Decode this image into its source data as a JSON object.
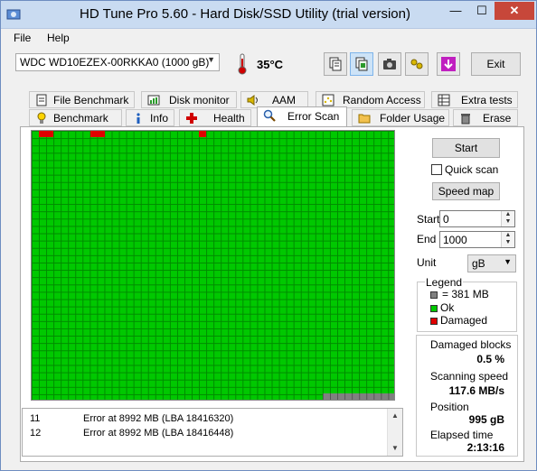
{
  "window": {
    "title": "HD Tune Pro 5.60 - Hard Disk/SSD Utility (trial version)"
  },
  "menu": [
    "File",
    "Help"
  ],
  "toolbar": {
    "drive": "WDC WD10EZEX-00RKKA0 (1000 gB)",
    "temperature": "35°C",
    "exit_label": "Exit",
    "buttons": [
      "copy-info-icon",
      "copy-screen-icon",
      "camera-icon",
      "options-icon",
      "save-download-icon"
    ]
  },
  "tabs_row1": [
    "File Benchmark",
    "Disk monitor",
    "AAM",
    "Random Access",
    "Extra tests"
  ],
  "tabs_row2": [
    "Benchmark",
    "Info",
    "Health",
    "Error Scan",
    "Folder Usage",
    "Erase"
  ],
  "active_tab": "Error Scan",
  "scan_log": [
    {
      "num": "11",
      "msg": "Error at 8992 MB (LBA 18416320)"
    },
    {
      "num": "12",
      "msg": "Error at 8992 MB (LBA 18416448)"
    }
  ],
  "controls": {
    "start_button": "Start",
    "quick_scan_label": "Quick scan",
    "quick_scan_checked": false,
    "speed_map_button": "Speed map",
    "start_label": "Start",
    "start_value": "0",
    "end_label": "End",
    "end_value": "1000",
    "unit_label": "Unit",
    "unit_value": "gB"
  },
  "legend": {
    "title": "Legend",
    "block_size": "= 381 MB",
    "ok": "Ok",
    "damaged": "Damaged",
    "colors": {
      "unscanned": "#808080",
      "ok": "#00c800",
      "damaged": "#e00000"
    }
  },
  "stats": {
    "damaged_blocks_label": "Damaged blocks",
    "damaged_blocks_value": "0.5 %",
    "scanning_speed_label": "Scanning speed",
    "scanning_speed_value": "117.6 MB/s",
    "position_label": "Position",
    "position_value": "995 gB",
    "elapsed_label": "Elapsed time",
    "elapsed_value": "2:13:16"
  }
}
